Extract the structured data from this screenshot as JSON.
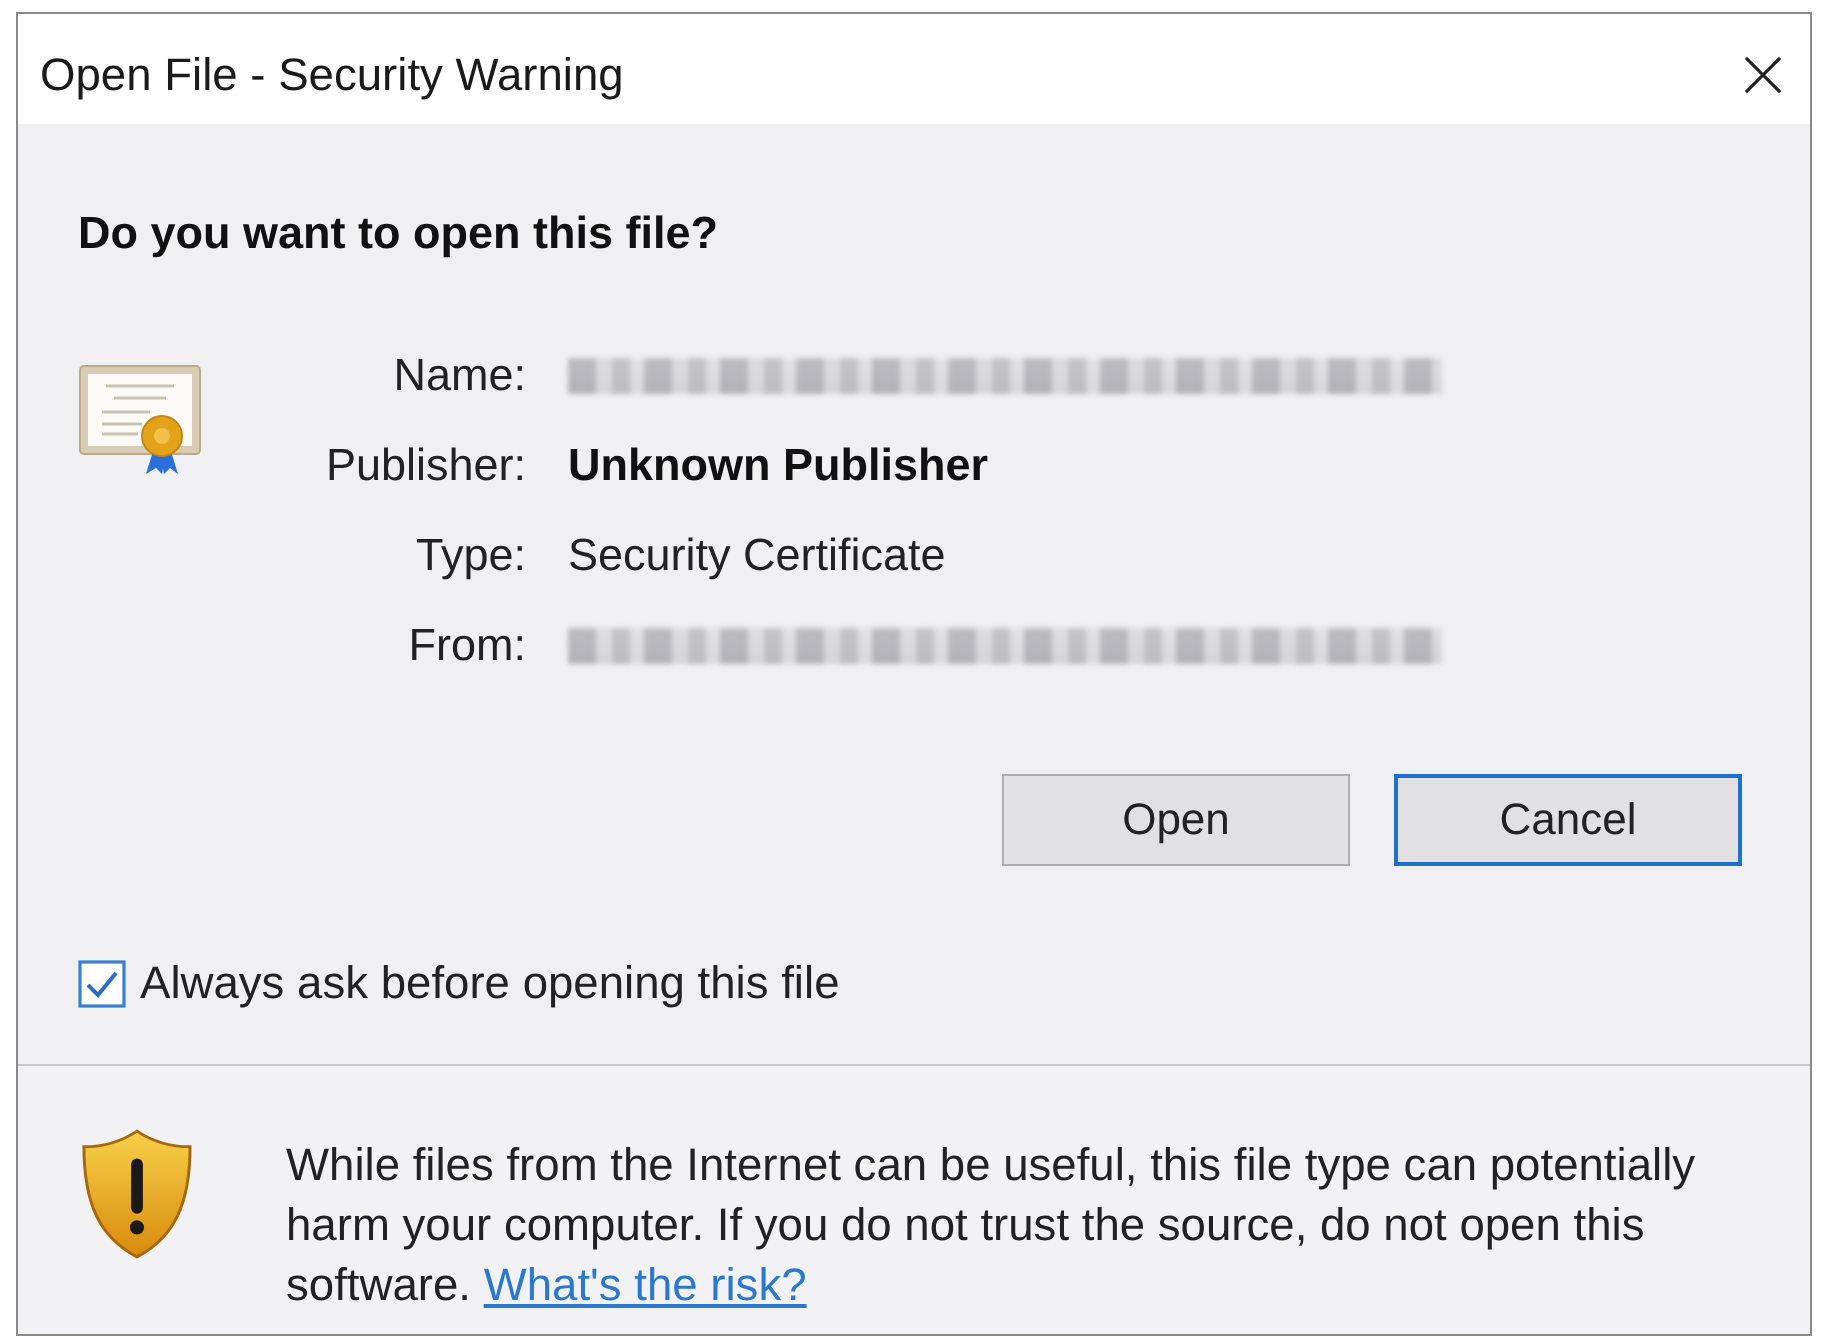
{
  "window": {
    "title": "Open File - Security Warning"
  },
  "heading": "Do you want to open this file?",
  "fields": [
    {
      "label": "Name:",
      "kind": "redacted"
    },
    {
      "label": "Publisher:",
      "kind": "bold",
      "value": "Unknown Publisher"
    },
    {
      "label": "Type:",
      "kind": "text",
      "value": "Security Certificate"
    },
    {
      "label": "From:",
      "kind": "redacted"
    }
  ],
  "buttons": [
    {
      "label": "Open",
      "focused": false
    },
    {
      "label": "Cancel",
      "focused": true
    }
  ],
  "checkbox": {
    "label": "Always ask before opening this file",
    "checked": true
  },
  "warning": {
    "text": "While files from the Internet can be useful, this file type can potentially harm your computer. If you do not trust the source, do not open this software.",
    "link": "What's the risk?"
  }
}
